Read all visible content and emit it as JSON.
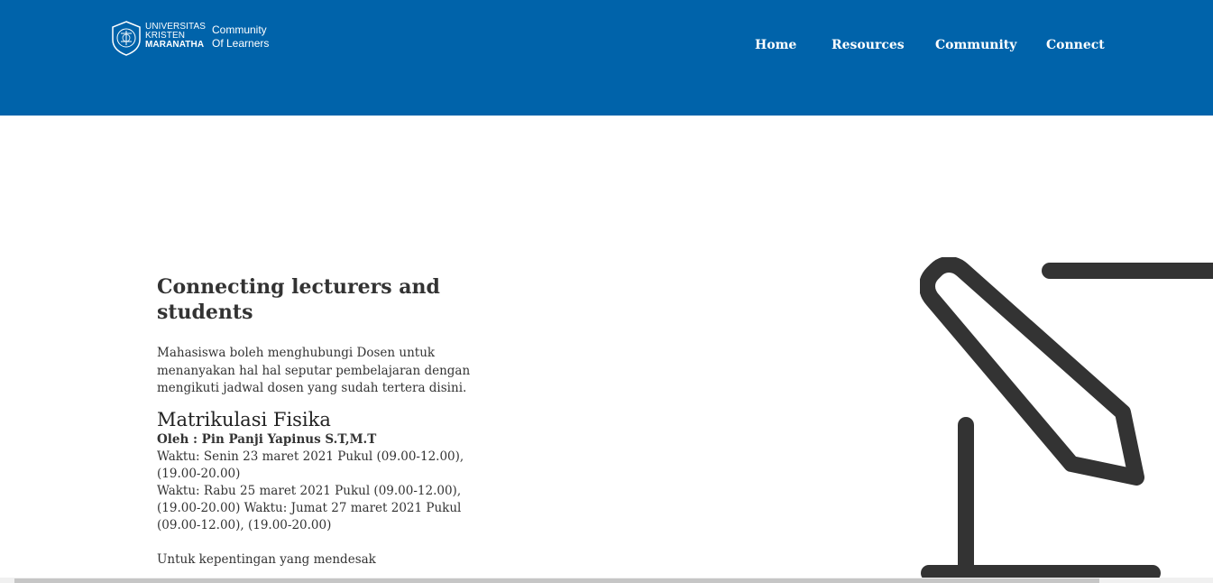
{
  "header": {
    "logo": {
      "university": [
        "UNIVERSITAS",
        "KRISTEN",
        "MARANATHA"
      ],
      "tagline": [
        "Community",
        "Of Learners"
      ]
    },
    "nav": [
      {
        "label": "Home"
      },
      {
        "label": "Resources"
      },
      {
        "label": "Community"
      },
      {
        "label": "Connect"
      }
    ]
  },
  "colors": {
    "header_bg": "#0063aa",
    "text": "#333333",
    "illustration_stroke": "#333333"
  },
  "main": {
    "heading_lines": [
      "Connecting lecturers and",
      "students"
    ],
    "intro": "Mahasiswa boleh menghubungi Dosen untuk menanyakan hal hal seputar pembelajaran dengan mengikuti jadwal dosen yang sudah tertera disini.",
    "course": {
      "title": "Matrikulasi Fisika",
      "lecturer": "Oleh : Pin Panji Yapinus S.T,M.T",
      "schedule_lines": [
        "Waktu: Senin 23 maret 2021 Pukul (09.00-12.00),",
        "(19.00-20.00)",
        "Waktu: Rabu 25 maret 2021 Pukul (09.00-12.00),",
        "(19.00-20.00) Waktu: Jumat 27 maret 2021 Pukul",
        "(09.00-12.00), (19.00-20.00)"
      ]
    },
    "note": "Untuk kepentingan yang mendesak"
  },
  "illustration": {
    "icon": "edit-pencil-icon"
  }
}
